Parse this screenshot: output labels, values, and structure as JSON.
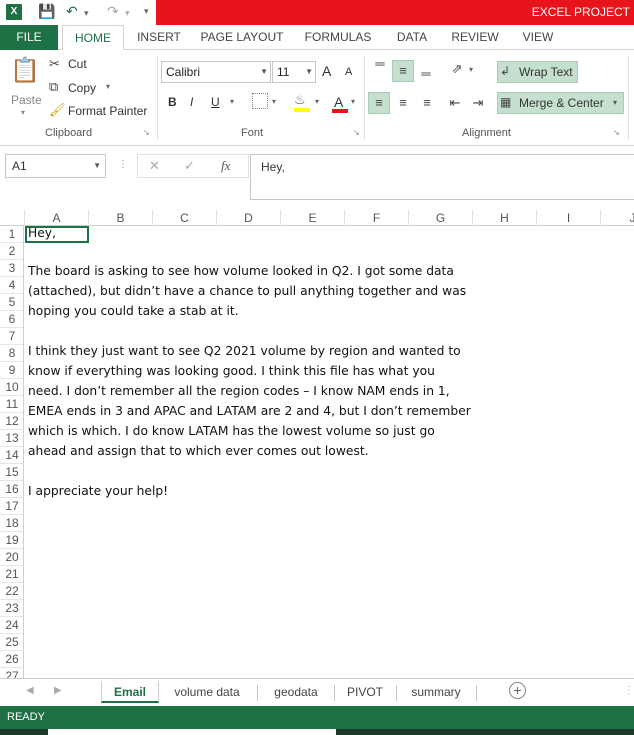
{
  "window": {
    "title": "EXCEL PROJECT",
    "app_icon": "X"
  },
  "quick_access": {
    "save": "save-icon",
    "undo": "undo-icon",
    "redo": "redo-icon"
  },
  "tabs": {
    "file": "FILE",
    "items": [
      "HOME",
      "INSERT",
      "PAGE LAYOUT",
      "FORMULAS",
      "DATA",
      "REVIEW",
      "VIEW"
    ],
    "active": "HOME"
  },
  "clipboard": {
    "paste": "Paste",
    "cut": "Cut",
    "copy": "Copy",
    "format_painter": "Format Painter",
    "label": "Clipboard"
  },
  "font": {
    "name": "Calibri",
    "size": "11",
    "grow": "A",
    "shrink": "A",
    "bold": "B",
    "italic": "I",
    "underline": "U",
    "color_letter": "A",
    "label": "Font"
  },
  "alignment": {
    "wrap_text": "Wrap Text",
    "merge_center": "Merge & Center",
    "label": "Alignment"
  },
  "formula_bar": {
    "name_box": "A1",
    "fx": "fx",
    "content": "Hey,"
  },
  "columns": [
    "A",
    "B",
    "C",
    "D",
    "E",
    "F",
    "G",
    "H",
    "I",
    "J"
  ],
  "rows": [
    "1",
    "2",
    "3",
    "4",
    "5",
    "6",
    "7",
    "8",
    "9",
    "10",
    "11",
    "12",
    "13",
    "14",
    "15",
    "16",
    "17",
    "18",
    "19",
    "20",
    "21",
    "22",
    "23",
    "24",
    "25",
    "26",
    "27"
  ],
  "cells": {
    "line1": "Hey,",
    "line2": "The board is asking to see how volume looked in Q2. I got some data",
    "line3": "(attached), but didn’t have a chance to pull anything together and was",
    "line4": "hoping you could take a stab at it.",
    "line5": "I think they just want to see Q2 2021 volume by region and wanted to",
    "line6": "know if everything was looking good. I think this file has what you",
    "line7": "need. I don’t remember all the region codes – I know NAM ends in 1,",
    "line8": "EMEA ends in 3 and APAC and LATAM are 2 and 4, but I don’t remember",
    "line9": "which is which. I do know LATAM has the lowest volume so just go",
    "line10": "ahead and assign that to which ever comes out lowest.",
    "line11": "I appreciate your help!"
  },
  "sheets": [
    "Email",
    "volume data",
    "geodata",
    "PIVOT",
    "summary"
  ],
  "active_sheet": "Email",
  "status": "READY",
  "colors": {
    "excel_green": "#1e7145",
    "title_red": "#e8141b"
  }
}
